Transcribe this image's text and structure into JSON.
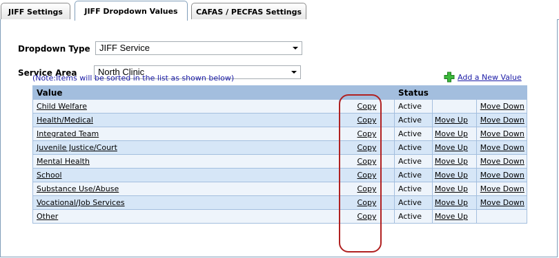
{
  "tabs": [
    {
      "label": "JIFF Settings"
    },
    {
      "label": "JIFF Dropdown Values"
    },
    {
      "label": "CAFAS / PECFAS Settings"
    }
  ],
  "form": {
    "dropdown_type_label": "Dropdown Type",
    "dropdown_type_value": "JIFF Service",
    "service_area_label": "Service Area",
    "service_area_value": "North Clinic"
  },
  "note": "(Note:Items will be sorted in the list as shown below)",
  "add_link": "Add a New Value",
  "colors": {
    "header_bg": "#a3bede",
    "row_light": "#eef4fb",
    "row_dark": "#d6e6f7",
    "highlight": "#b02020",
    "note_text": "#1a1aa6"
  },
  "table": {
    "headers": {
      "value": "Value",
      "status": "Status"
    },
    "rows": [
      {
        "value": "Child Welfare",
        "copy": "Copy",
        "status": "Active",
        "up": "",
        "down": "Move Down"
      },
      {
        "value": "Health/Medical",
        "copy": "Copy",
        "status": "Active",
        "up": "Move Up",
        "down": "Move Down"
      },
      {
        "value": "Integrated Team",
        "copy": "Copy",
        "status": "Active",
        "up": "Move Up",
        "down": "Move Down"
      },
      {
        "value": "Juvenile Justice/Court",
        "copy": "Copy",
        "status": "Active",
        "up": "Move Up",
        "down": "Move Down"
      },
      {
        "value": "Mental Health",
        "copy": "Copy",
        "status": "Active",
        "up": "Move Up",
        "down": "Move Down"
      },
      {
        "value": "School",
        "copy": "Copy",
        "status": "Active",
        "up": "Move Up",
        "down": "Move Down"
      },
      {
        "value": "Substance Use/Abuse",
        "copy": "Copy",
        "status": "Active",
        "up": "Move Up",
        "down": "Move Down"
      },
      {
        "value": "Vocational/Job Services",
        "copy": "Copy",
        "status": "Active",
        "up": "Move Up",
        "down": "Move Down"
      },
      {
        "value": "Other",
        "copy": "Copy",
        "status": "Active",
        "up": "Move Up",
        "down": ""
      }
    ]
  }
}
